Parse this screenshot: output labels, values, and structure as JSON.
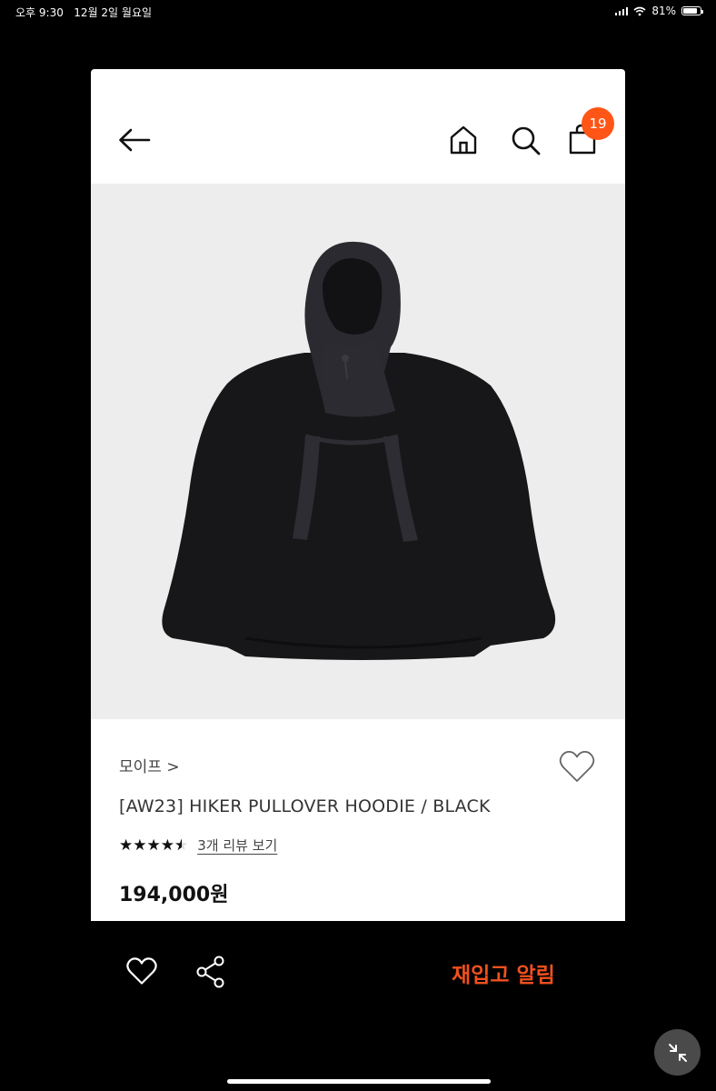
{
  "status_bar": {
    "time": "오후 9:30",
    "date": "12월 2일 월요일",
    "battery": "81%",
    "battery_level": 0.81
  },
  "header": {
    "back_icon": "arrow-left-icon",
    "home_icon": "home-icon",
    "search_icon": "search-icon",
    "cart_icon": "shopping-bag-icon",
    "cart_count": "19",
    "badge_color": "#ff5516"
  },
  "product": {
    "image": "black pullover hoodie photo",
    "brand": "모이프 >",
    "title": "[AW23] HIKER PULLOVER HOODIE / BLACK",
    "rating_stars": 4.5,
    "stars_text": "★★★★★",
    "review_link": "3개 리뷰 보기",
    "price": "194,000원"
  },
  "bottom_bar": {
    "heart_icon": "heart-icon",
    "share_icon": "share-icon",
    "restock_label": "재입고 알림",
    "accent_color": "#f0501e"
  }
}
